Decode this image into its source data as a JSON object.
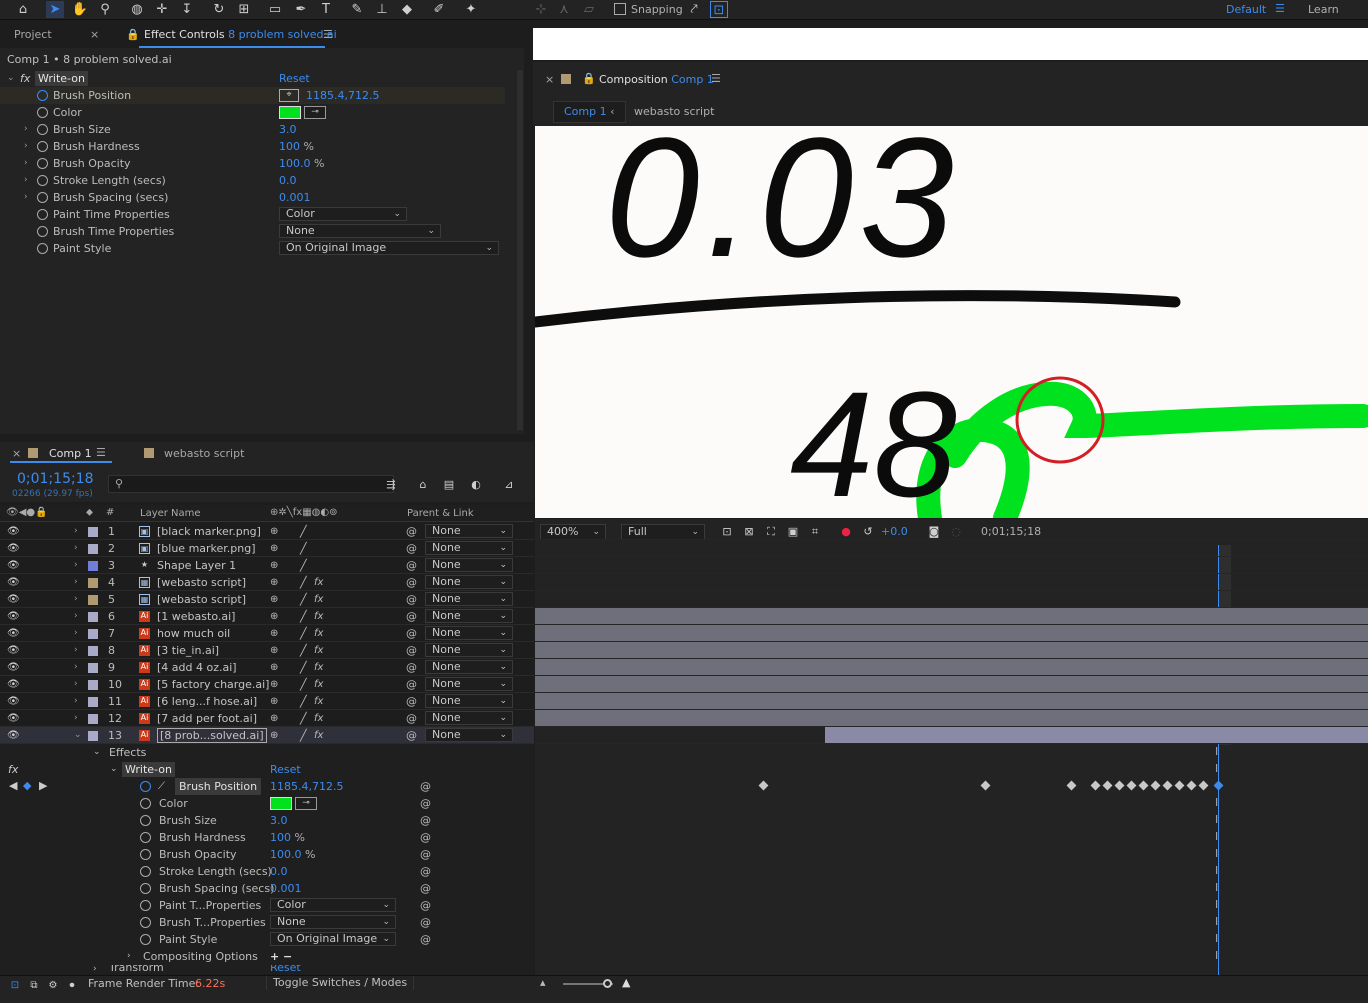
{
  "toolbar": {
    "snapping_label": "Snapping",
    "workspace": "Default",
    "learn": "Learn"
  },
  "left_panel": {
    "tab_project": "Project",
    "tab_effect_controls": "Effect Controls",
    "tab_effect_controls_file": "8 problem solved.ai",
    "breadcrumb": "Comp 1 • 8 problem solved.ai",
    "effect_name": "Write-on",
    "reset_label": "Reset",
    "properties": [
      {
        "name": "Brush Position",
        "value": "1185.4,712.5"
      },
      {
        "name": "Color",
        "value": ""
      },
      {
        "name": "Brush Size",
        "value": "3.0"
      },
      {
        "name": "Brush Hardness",
        "value": "100",
        "unit": "%"
      },
      {
        "name": "Brush Opacity",
        "value": "100.0",
        "unit": "%"
      },
      {
        "name": "Stroke Length (secs)",
        "value": "0.0"
      },
      {
        "name": "Brush Spacing (secs)",
        "value": "0.001"
      },
      {
        "name": "Paint Time Properties",
        "value": "Color"
      },
      {
        "name": "Brush Time Properties",
        "value": "None"
      },
      {
        "name": "Paint Style",
        "value": "On Original Image"
      }
    ]
  },
  "comp_viewer": {
    "panel_title": "Composition",
    "comp_name": "Comp 1",
    "tab_comp1": "Comp 1",
    "tab_script": "webasto script",
    "zoom": "400%",
    "resolution": "Full",
    "exposure": "+0.0",
    "timecode": "0;01;15;18",
    "canvas_text_top": "0.03",
    "canvas_text_bottom": "48"
  },
  "timeline": {
    "tab_comp1": "Comp 1",
    "tab_script": "webasto script",
    "timecode": "0;01;15;18",
    "frame_info": "02266 (29.97 fps)",
    "col_layer_name": "Layer Name",
    "col_parent": "Parent & Link",
    "layers": [
      {
        "num": "1",
        "name": "[black marker.png]",
        "parent": "None",
        "color": "#a9a9c8",
        "kind": "img",
        "fx": false
      },
      {
        "num": "2",
        "name": "[blue marker.png]",
        "parent": "None",
        "color": "#a9a9c8",
        "kind": "img",
        "fx": false
      },
      {
        "num": "3",
        "name": "Shape Layer 1",
        "parent": "None",
        "color": "#6f7fd8",
        "kind": "star",
        "fx": false
      },
      {
        "num": "4",
        "name": "[webasto script]",
        "parent": "None",
        "color": "#b19a72",
        "kind": "comp",
        "fx": true
      },
      {
        "num": "5",
        "name": "[webasto script]",
        "parent": "None",
        "color": "#b19a72",
        "kind": "comp",
        "fx": true
      },
      {
        "num": "6",
        "name": "[1 webasto.ai]",
        "parent": "None",
        "color": "#a9a9c8",
        "kind": "ai",
        "fx": true
      },
      {
        "num": "7",
        "name": "how much oil",
        "parent": "None",
        "color": "#a9a9c8",
        "kind": "ai",
        "fx": true
      },
      {
        "num": "8",
        "name": "[3 tie_in.ai]",
        "parent": "None",
        "color": "#a9a9c8",
        "kind": "ai",
        "fx": true
      },
      {
        "num": "9",
        "name": "[4 add 4 oz.ai]",
        "parent": "None",
        "color": "#a9a9c8",
        "kind": "ai",
        "fx": true
      },
      {
        "num": "10",
        "name": "[5 factory charge.ai]",
        "parent": "None",
        "color": "#a9a9c8",
        "kind": "ai",
        "fx": true
      },
      {
        "num": "11",
        "name": "[6 leng...f hose.ai]",
        "parent": "None",
        "color": "#a9a9c8",
        "kind": "ai",
        "fx": true
      },
      {
        "num": "12",
        "name": "[7 add per foot.ai]",
        "parent": "None",
        "color": "#a9a9c8",
        "kind": "ai",
        "fx": true
      },
      {
        "num": "13",
        "name": "[8 prob...solved.ai]",
        "parent": "None",
        "color": "#a9a9c8",
        "kind": "ai",
        "fx": true
      }
    ],
    "effects_label": "Effects",
    "effect_name": "Write-on",
    "reset_label": "Reset",
    "effect_props": [
      {
        "name": "Brush Position",
        "value": "1185.4,712.5"
      },
      {
        "name": "Color",
        "value": ""
      },
      {
        "name": "Brush Size",
        "value": "3.0"
      },
      {
        "name": "Brush Hardness",
        "value": "100",
        "unit": "%"
      },
      {
        "name": "Brush Opacity",
        "value": "100.0",
        "unit": "%"
      },
      {
        "name": "Stroke Length (secs)",
        "value": "0.0"
      },
      {
        "name": "Brush Spacing (secs)",
        "value": "0.001"
      },
      {
        "name": "Paint T...Properties",
        "value": "Color"
      },
      {
        "name": "Brush T...Properties",
        "value": "None"
      },
      {
        "name": "Paint Style",
        "value": "On Original Image"
      }
    ],
    "compositing_label": "Compositing Options",
    "transform_label": "Transform",
    "transform_reset": "Reset"
  },
  "status_bar": {
    "render_label": "Frame Render Time:",
    "render_value": "6.22s",
    "toggle_label": "Toggle Switches / Modes"
  },
  "colors": {
    "accent": "#3c8cf0",
    "brush_green": "#00e21e",
    "circle_red": "#d11f25"
  }
}
